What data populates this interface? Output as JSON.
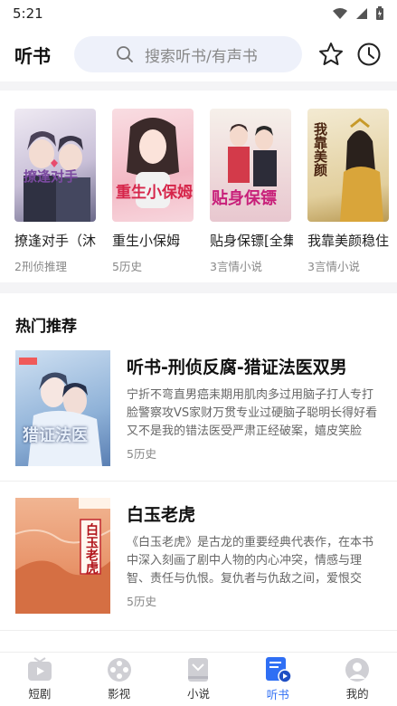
{
  "status_bar": {
    "time": "5:21"
  },
  "header": {
    "title": "听书",
    "search_placeholder": "搜索听书/有声书",
    "icons": [
      "star-icon",
      "clock-icon",
      "search-icon"
    ]
  },
  "shelf": {
    "books": [
      {
        "title": "撩逢对手（沐",
        "meta": "2刑侦推理",
        "cover_text": "撩逢对手",
        "cover_color": "#c9c0d8"
      },
      {
        "title": "重生小保姆",
        "meta": "5历史",
        "cover_text": "重生小保姆",
        "cover_color": "#f3b9c5"
      },
      {
        "title": "贴身保镖[全集",
        "meta": "3言情小说",
        "cover_text": "贴身保镖",
        "cover_color": "#e8c7cf"
      },
      {
        "title": "我靠美颜稳住",
        "meta": "3言情小说",
        "cover_text": "我靠美颜",
        "cover_color": "#e2cf9d"
      }
    ]
  },
  "recommend": {
    "title": "热门推荐",
    "items": [
      {
        "title": "听书-刑侦反腐-猎证法医双男",
        "desc": "宁折不弯直男癌耒期用肌肉多过用脑子打人专打脸警察攻VS家财万贯专业过硬脑子聪明长得好看又不是我的错法医受严肃正经破案，嬉皮笑脸",
        "meta": "5历史",
        "cover_text": "猎证法医",
        "cover_color": "#8fb2d8"
      },
      {
        "title": "白玉老虎",
        "desc": "《白玉老虎》是古龙的重要经典代表作，在本书中深入刻画了剧中人物的内心冲突，情感与理智、责任与仇恨。复仇者与仇敌之间，爱恨交",
        "meta": "5历史",
        "cover_text": "白玉老虎",
        "cover_color": "#e8946a"
      }
    ]
  },
  "tabbar": {
    "tabs": [
      {
        "label": "短剧",
        "icon": "tv-icon"
      },
      {
        "label": "影视",
        "icon": "film-reel-icon"
      },
      {
        "label": "小说",
        "icon": "book-icon"
      },
      {
        "label": "听书",
        "icon": "audiobook-icon"
      },
      {
        "label": "我的",
        "icon": "profile-icon"
      }
    ],
    "active_index": 3,
    "accent_color": "#2f6ff4"
  }
}
